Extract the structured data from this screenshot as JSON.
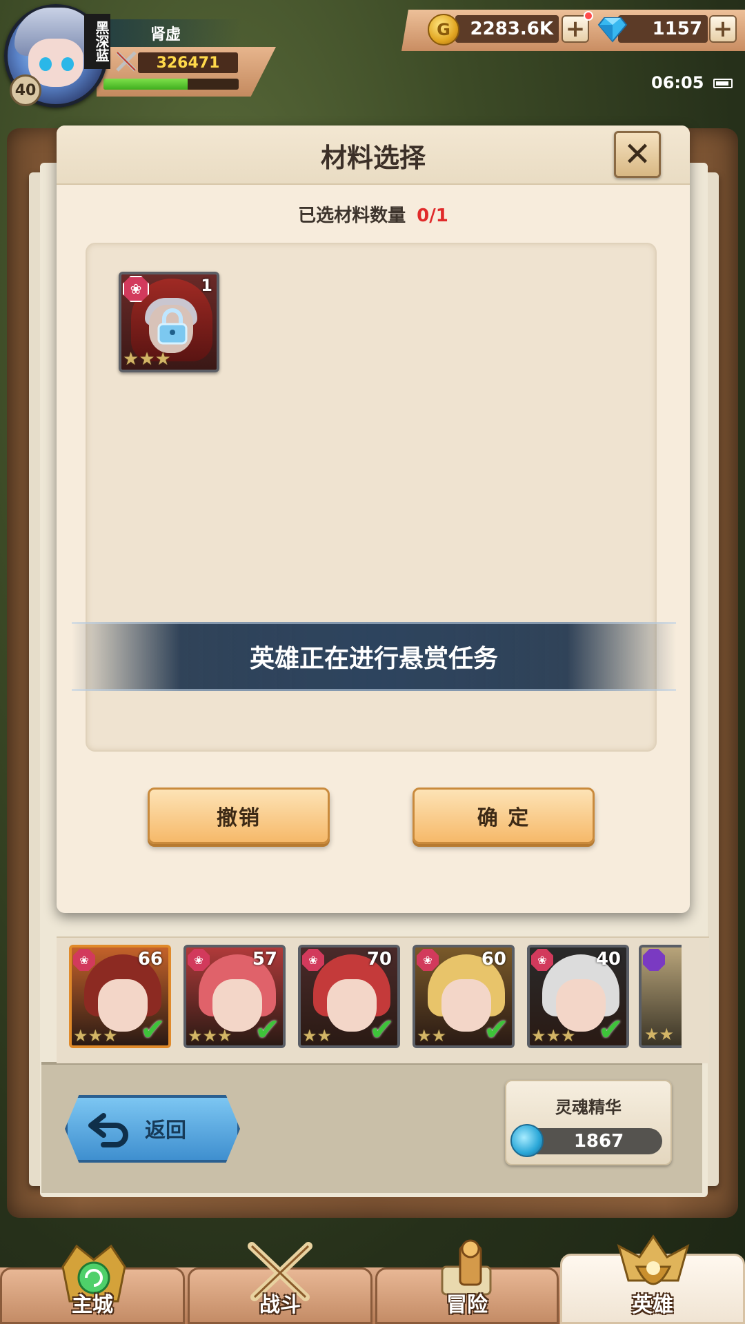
{
  "player": {
    "name": "肾虚",
    "level": "40",
    "guild_tag": "黑深蓝",
    "power": "326471",
    "xp_progress": 0.62
  },
  "currency": {
    "gold": "2283.6K",
    "gems": "1157",
    "plus": "+"
  },
  "status": {
    "time": "06:05"
  },
  "dialog": {
    "title": "材料选择",
    "close": "✕",
    "count_label": "已选材料数量",
    "count_value": "0/1",
    "selected_material": {
      "level": "1",
      "stars": 3,
      "locked": true,
      "type_icon": "flower-icon"
    },
    "notice": "英雄正在进行悬赏任务",
    "cancel": "撤销",
    "confirm": "确 定"
  },
  "heroes": [
    {
      "level": "66",
      "stars": 3,
      "selected": true,
      "hair": "#8c2a22",
      "bg": "#c4622a"
    },
    {
      "level": "57",
      "stars": 3,
      "selected": true,
      "hair": "#e0626a",
      "bg": "#b03a3a"
    },
    {
      "level": "70",
      "stars": 2,
      "selected": true,
      "hair": "#c43a3a",
      "bg": "#4a2a2a"
    },
    {
      "level": "60",
      "stars": 2,
      "selected": true,
      "hair": "#e8c46a",
      "bg": "#7a5a2a"
    },
    {
      "level": "40",
      "stars": 3,
      "selected": true,
      "hair": "#dcdcdc",
      "bg": "#2a2a2a"
    }
  ],
  "bottom": {
    "back": "返回",
    "soul_label": "灵魂精华",
    "soul_value": "1867"
  },
  "nav": [
    {
      "label": "主城",
      "icon": "castle-icon",
      "active": false
    },
    {
      "label": "战斗",
      "icon": "crossed-swords-icon",
      "active": false
    },
    {
      "label": "冒险",
      "icon": "scroll-map-icon",
      "active": false
    },
    {
      "label": "英雄",
      "icon": "hero-helmet-icon",
      "active": true
    }
  ],
  "colors": {
    "accent_red": "#e02a2a",
    "button_orange": "#f6b96a",
    "check_green": "#3ec43a"
  }
}
